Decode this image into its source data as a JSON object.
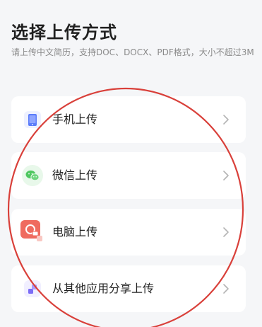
{
  "header": {
    "title": "选择上传方式",
    "subtitle": "请上传中文简历，支持DOC、DOCX、PDF格式，大小不超过3M"
  },
  "options": [
    {
      "label": "手机上传",
      "icon": "phone-icon",
      "icon_color": "#5b7cfa"
    },
    {
      "label": "微信上传",
      "icon": "wechat-icon",
      "icon_color": "#4fc760"
    },
    {
      "label": "电脑上传",
      "icon": "computer-icon",
      "icon_color": "#ef6b5f"
    },
    {
      "label": "从其他应用分享上传",
      "icon": "share-icon",
      "icon_color": "#7b6cf6"
    }
  ],
  "annotation_color": "#d9403a"
}
